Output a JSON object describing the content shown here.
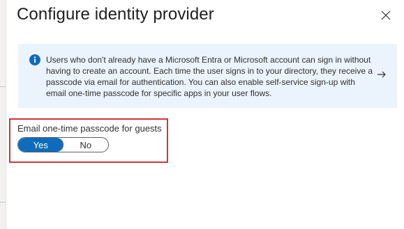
{
  "panel": {
    "title": "Configure identity provider",
    "close_icon": "close-icon"
  },
  "info": {
    "icon": "info-icon",
    "text": "Users who don't already have a Microsoft Entra or Microsoft account can sign in without having to create an account. Each time the user signs in to your directory, they receive a passcode via email for authentication. You can also enable self-service sign-up with email one-time passcode for specific apps in your user flows.",
    "arrow_icon": "arrow-right-icon",
    "background": "#ebf3fc",
    "icon_color": "#0f6cbd"
  },
  "setting": {
    "label": "Email one-time passcode for guests",
    "options": [
      "Yes",
      "No"
    ],
    "selected": "Yes",
    "accent": "#0f6cbd",
    "highlight_color": "#d13438"
  }
}
